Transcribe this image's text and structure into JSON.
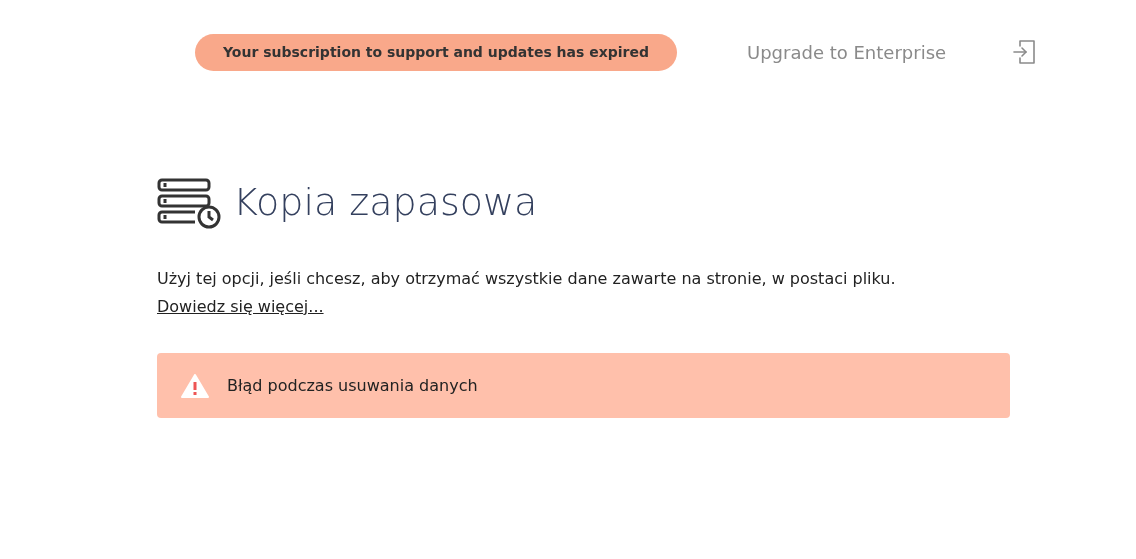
{
  "header": {
    "subscription_badge": "Your subscription to support and updates has expired",
    "upgrade_link": "Upgrade to Enterprise"
  },
  "page": {
    "title": "Kopia zapasowa",
    "description": "Użyj tej opcji, jeśli chcesz, aby otrzymać wszystkie dane zawarte na stronie, w postaci pliku.",
    "learn_more_link": "Dowiedz się więcej..."
  },
  "alert": {
    "kind": "error",
    "message": "Błąd podczas usuwania danych"
  }
}
